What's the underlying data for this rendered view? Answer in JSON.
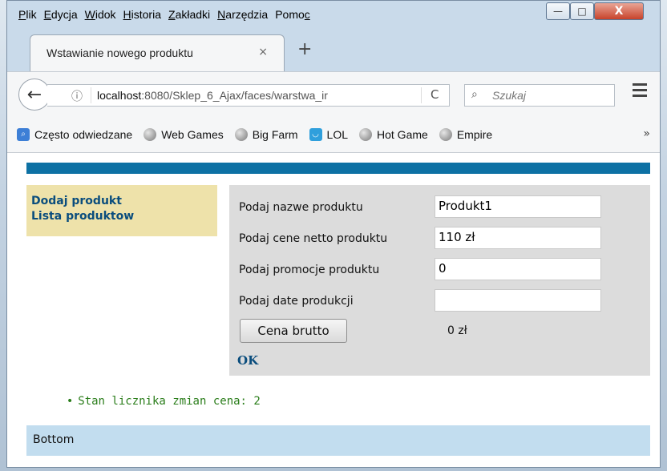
{
  "menubar": {
    "items": [
      {
        "label": "Plik",
        "u": "P",
        "rest": "lik"
      },
      {
        "label": "Edycja",
        "u": "E",
        "rest": "dycja"
      },
      {
        "label": "Widok",
        "u": "W",
        "rest": "idok"
      },
      {
        "label": "Historia",
        "u": "H",
        "rest": "istoria"
      },
      {
        "label": "Zakładki",
        "u": "Z",
        "rest": "akładki"
      },
      {
        "label": "Narzędzia",
        "u": "N",
        "rest": "arzędzia"
      },
      {
        "label": "Pomoc",
        "pre": "Pomo",
        "u": "c"
      }
    ]
  },
  "window_controls": {
    "minimize": "—",
    "maximize": "□",
    "close": "X"
  },
  "tab": {
    "title": "Wstawianie nowego produktu",
    "close": "×",
    "new_tab": "+"
  },
  "navbar": {
    "back": "←",
    "info": "ⓘ",
    "url_host": "localhost",
    "url_rest": ":8080/Sklep_6_Ajax/faces/warstwa_ir",
    "reload": "C",
    "search_icon": "⌕",
    "search_placeholder": "Szukaj"
  },
  "bookmarks": {
    "items": [
      {
        "label": "Często odwiedzane",
        "icon": "bookmark-icon"
      },
      {
        "label": "Web Games",
        "icon": "globe-icon"
      },
      {
        "label": "Big Farm",
        "icon": "globe-icon"
      },
      {
        "label": "LOL",
        "icon": "lol-icon"
      },
      {
        "label": "Hot Game",
        "icon": "globe-icon"
      },
      {
        "label": "Empire",
        "icon": "globe-icon"
      }
    ],
    "more": "»"
  },
  "page": {
    "nav": {
      "add": "Dodaj produkt",
      "list": "Lista produktow"
    },
    "form": {
      "name_label": "Podaj nazwe produktu",
      "name_value": "Produkt1",
      "price_label": "Podaj cene netto produktu",
      "price_value": "110 zł",
      "promo_label": "Podaj promocje produktu",
      "promo_value": "0",
      "date_label": "Podaj date produkcji",
      "date_value": "",
      "gross_button": "Cena brutto",
      "gross_result": "0 zł",
      "ok": "OK"
    },
    "counter": {
      "bullet": "•",
      "text": "Stan licznika zmian cena: 2"
    },
    "footer": "Bottom"
  },
  "colors": {
    "stripe": "#0d71a4",
    "leftnav_bg": "#eee2aa",
    "form_bg": "#dcdcdc",
    "footer_bg": "#c2ddef",
    "counter_text": "#2a7d1a"
  }
}
